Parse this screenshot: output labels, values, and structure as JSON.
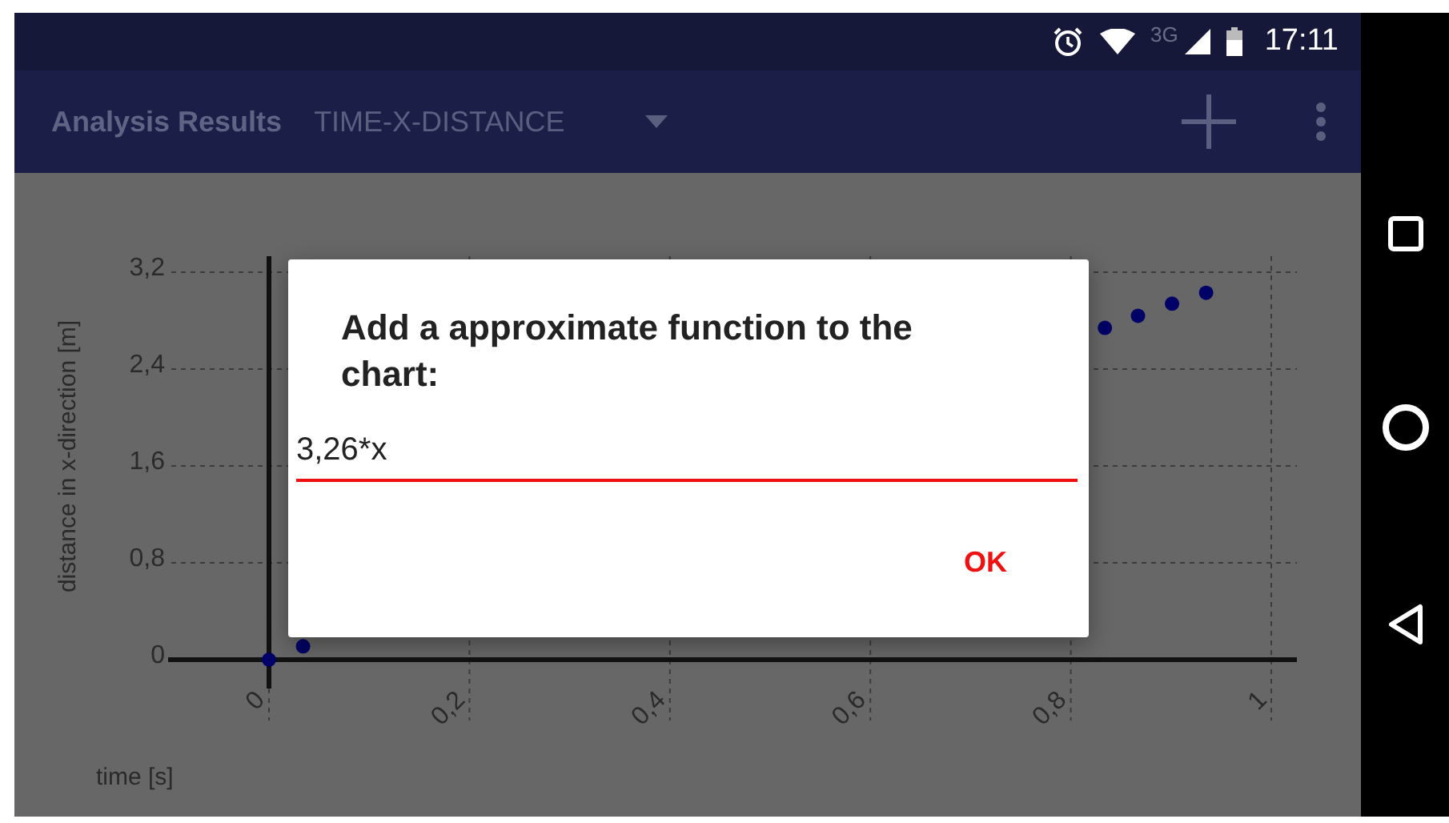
{
  "status_bar": {
    "network": "3G",
    "time": "17:11"
  },
  "app_bar": {
    "title": "Analysis Results",
    "spinner": "TIME-X-DISTANCE"
  },
  "chart": {
    "chart_data": {
      "type": "scatter",
      "grid": true,
      "xlabel": "time [s]",
      "ylabel": "distance in x-direction [m]",
      "x": [
        0,
        0.034,
        0.834,
        0.867,
        0.901,
        0.935
      ],
      "series": [
        {
          "color": "#000066",
          "values": [
            0,
            0.11,
            2.74,
            2.84,
            2.94,
            3.03
          ]
        }
      ],
      "xlim": [
        0,
        1
      ],
      "ylim": [
        0,
        3.2
      ],
      "xticks": [
        0,
        {
          "value": 0.2,
          "label": "0,2"
        },
        {
          "value": 0.4,
          "label": "0,4"
        },
        {
          "value": 0.6,
          "label": "0,6"
        },
        {
          "value": 0.8,
          "label": "0,8"
        },
        1
      ],
      "yticks": [
        0,
        {
          "value": 0.8,
          "label": "0,8"
        },
        {
          "value": 1.6,
          "label": "1,6"
        },
        {
          "value": 2.4,
          "label": "2,4"
        },
        {
          "value": 3.2,
          "label": "3,2"
        }
      ]
    }
  },
  "dialog": {
    "title": "Add a approximate function to the chart:",
    "input": "3,26*x",
    "button": "OK"
  }
}
